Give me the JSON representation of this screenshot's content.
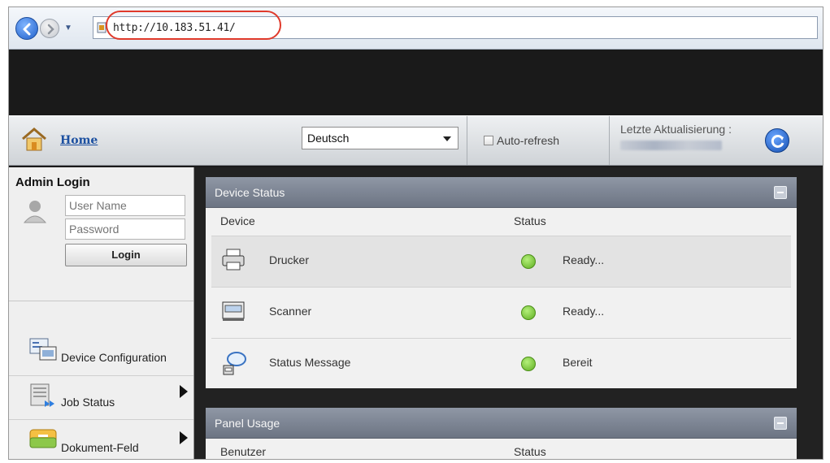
{
  "browser": {
    "address_url": "http://10.183.51.41/"
  },
  "header": {
    "home_label": "Home",
    "language_selected": "Deutsch",
    "auto_refresh_label": "Auto-refresh",
    "last_update_label": "Letzte Aktualisierung :"
  },
  "sidebar": {
    "admin_login_title": "Admin Login",
    "username_placeholder": "User Name",
    "password_placeholder": "Password",
    "login_button": "Login",
    "items": [
      {
        "label": "Device Configuration",
        "icon": "device-configuration-icon",
        "has_submenu": false
      },
      {
        "label": "Job Status",
        "icon": "job-status-icon",
        "has_submenu": true
      },
      {
        "label": "Dokument-Feld",
        "icon": "document-box-icon",
        "has_submenu": true
      }
    ]
  },
  "device_status": {
    "title": "Device Status",
    "col_device": "Device",
    "col_status": "Status",
    "rows": [
      {
        "device": "Drucker",
        "status": "Ready...",
        "icon": "printer-icon",
        "status_color": "#7bd13a"
      },
      {
        "device": "Scanner",
        "status": "Ready...",
        "icon": "scanner-icon",
        "status_color": "#7bd13a"
      },
      {
        "device": "Status Message",
        "status": "Bereit",
        "icon": "status-message-icon",
        "status_color": "#7bd13a"
      }
    ]
  },
  "panel_usage": {
    "title": "Panel Usage",
    "col_user": "Benutzer",
    "col_status": "Status"
  },
  "colors": {
    "highlight_circle": "#e03a2b",
    "link_blue": "#1b4fa0",
    "panel_header": "#7a8291",
    "status_green": "#7bd13a"
  }
}
